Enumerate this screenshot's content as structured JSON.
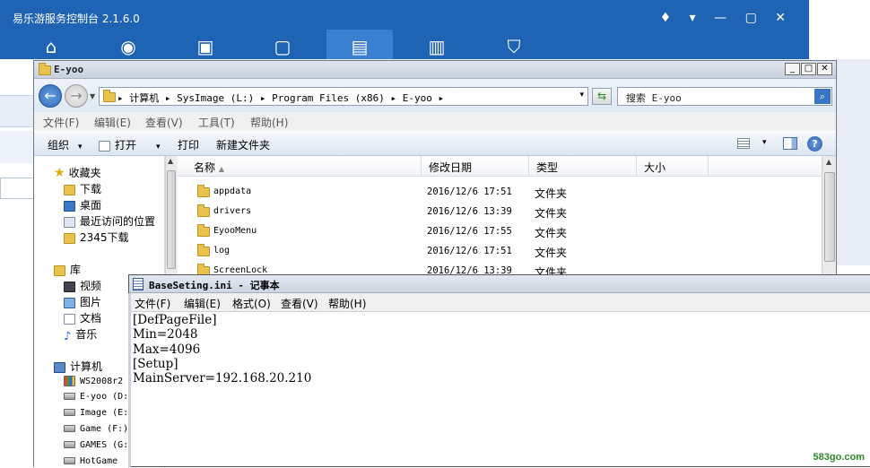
{
  "background_app": {
    "title": "易乐游服务控制台 2.1.6.0",
    "window_controls": "♦ ▾ — ▢ ✕",
    "nav_icons": [
      "home-icon",
      "eye-icon",
      "gamepad-icon",
      "window-icon",
      "document-icon",
      "toolbox-icon",
      "shield-icon"
    ],
    "colors": {
      "header": "#1f63b4",
      "active_tab": "#3b7fd0"
    }
  },
  "explorer": {
    "title": "E-yoo",
    "window_buttons": {
      "minimize": "_",
      "maximize": "□",
      "close": "✕"
    },
    "address": {
      "crumbs": "▸ 计算机 ▸ SysImage (L:) ▸ Program Files (x86) ▸ E-yoo ▸",
      "dropdown": "▾"
    },
    "search_placeholder": "搜索 E-yoo",
    "menu": [
      "文件(F)",
      "编辑(E)",
      "查看(V)",
      "工具(T)",
      "帮助(H)"
    ],
    "toolbar": {
      "organize": "组织",
      "open": "打开",
      "print": "打印",
      "new_folder": "新建文件夹",
      "caret": "▾",
      "help": "?"
    },
    "nav": {
      "favorites": "收藏夹",
      "fav_items": [
        "下载",
        "桌面",
        "最近访问的位置",
        "2345下载"
      ],
      "library": "库",
      "lib_items": [
        "视频",
        "图片",
        "文档",
        "音乐"
      ],
      "computer": "计算机",
      "drives": [
        "WS2008r2",
        "E-yoo (D:",
        "Image (E:",
        "Game (F:)",
        "GAMES (G:",
        "HotGame"
      ]
    },
    "columns": [
      "名称",
      "修改日期",
      "类型",
      "大小"
    ],
    "files": [
      {
        "name": "appdata",
        "date": "2016/12/6 17:51",
        "type": "文件夹"
      },
      {
        "name": "drivers",
        "date": "2016/12/6 13:39",
        "type": "文件夹"
      },
      {
        "name": "EyooMenu",
        "date": "2016/12/6 17:55",
        "type": "文件夹"
      },
      {
        "name": "log",
        "date": "2016/12/6 17:51",
        "type": "文件夹"
      },
      {
        "name": "ScreenLock",
        "date": "2016/12/6 13:39",
        "type": "文件夹"
      }
    ]
  },
  "notepad": {
    "title": "BaseSeting.ini - 记事本",
    "menu": [
      "文件(F)",
      "编辑(E)",
      "格式(O)",
      "查看(V)",
      "帮助(H)"
    ],
    "content": "[DefPageFile]\nMin=2048\nMax=4096\n[Setup]\nMainServer=192.168.20.210"
  },
  "watermark": "583go.com"
}
